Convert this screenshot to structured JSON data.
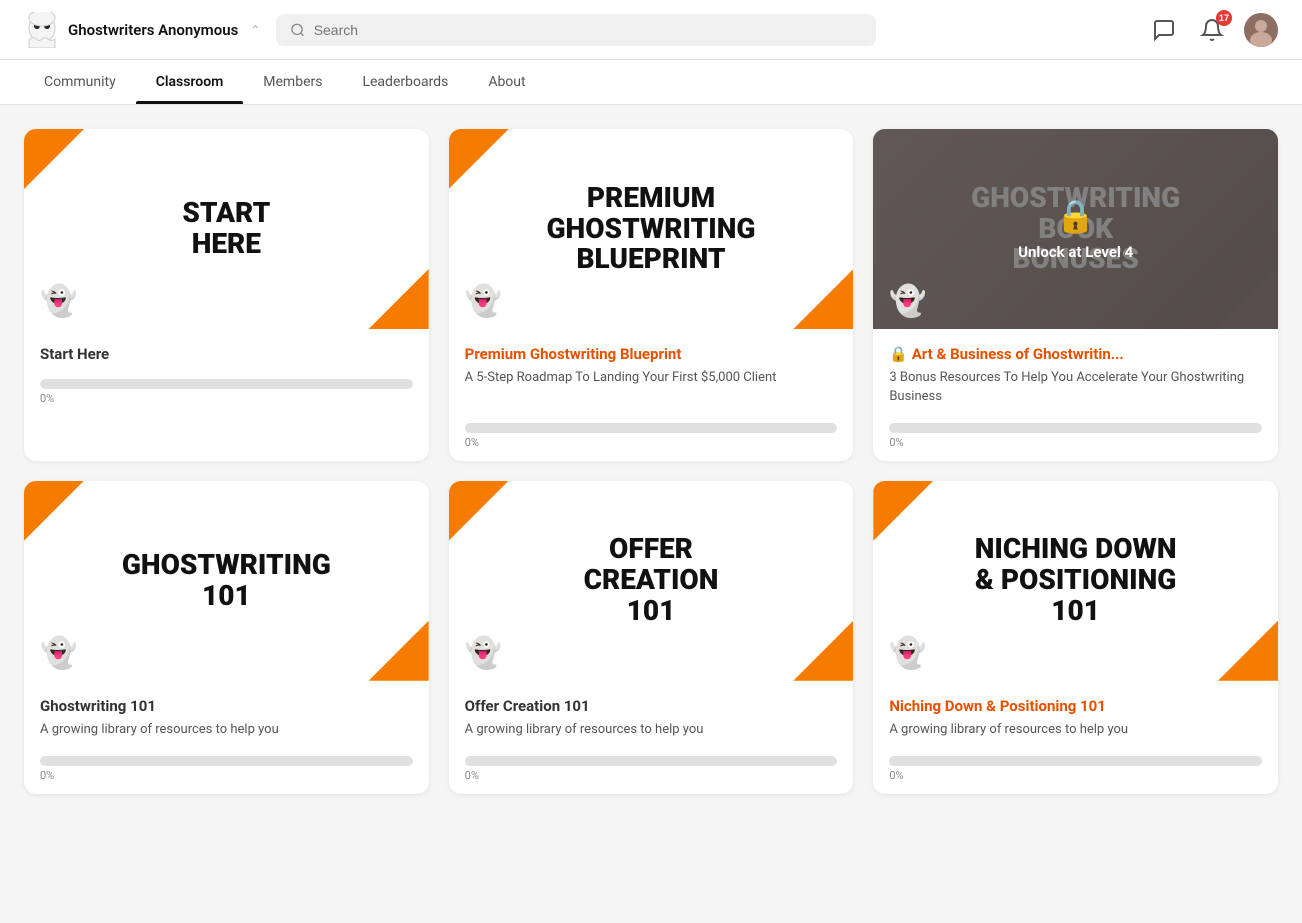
{
  "header": {
    "brand_name": "Ghostwriters Anonymous",
    "search_placeholder": "Search",
    "notif_count": "17"
  },
  "nav": {
    "items": [
      {
        "label": "Community",
        "active": false
      },
      {
        "label": "Classroom",
        "active": true
      },
      {
        "label": "Members",
        "active": false
      },
      {
        "label": "Leaderboards",
        "active": false
      },
      {
        "label": "About",
        "active": false
      }
    ]
  },
  "cards": [
    {
      "id": "start-here",
      "image_title": "START\nHERE",
      "locked": false,
      "brown": false,
      "course_title": "Start Here",
      "course_title_color": "plain",
      "description": "",
      "progress": 0
    },
    {
      "id": "premium-ghostwriting-blueprint",
      "image_title": "PREMIUM\nGHOSTWRITING\nBLUEPRINT",
      "locked": false,
      "brown": false,
      "course_title": "Premium Ghostwriting Blueprint",
      "course_title_color": "orange",
      "description": "A 5-Step Roadmap To Landing Your First $5,000 Client",
      "progress": 0
    },
    {
      "id": "ghostwriting-book-bonuses",
      "image_title": "GHOSTWRITING\nBOOK\nBONUSES",
      "locked": true,
      "lock_text": "Unlock at Level 4",
      "brown": true,
      "course_title": "🔒 Art & Business of Ghostwritin...",
      "course_title_color": "orange",
      "description": "3 Bonus Resources To Help You Accelerate Your Ghostwriting Business",
      "progress": 0
    },
    {
      "id": "ghostwriting-101",
      "image_title": "GHOSTWRITING\n101",
      "locked": false,
      "brown": false,
      "course_title": "Ghostwriting 101",
      "course_title_color": "plain",
      "description": "A growing library of resources to help you",
      "progress": 0
    },
    {
      "id": "offer-creation-101",
      "image_title": "OFFER\nCREATION\n101",
      "locked": false,
      "brown": false,
      "course_title": "Offer Creation 101",
      "course_title_color": "plain",
      "description": "A growing library of resources to help you",
      "progress": 0
    },
    {
      "id": "niching-down-positioning",
      "image_title": "NICHING DOWN\n& POSITIONING\n101",
      "locked": false,
      "brown": false,
      "course_title": "Niching Down & Positioning 101",
      "course_title_color": "orange",
      "description": "A growing library of resources to help you",
      "progress": 0
    }
  ]
}
